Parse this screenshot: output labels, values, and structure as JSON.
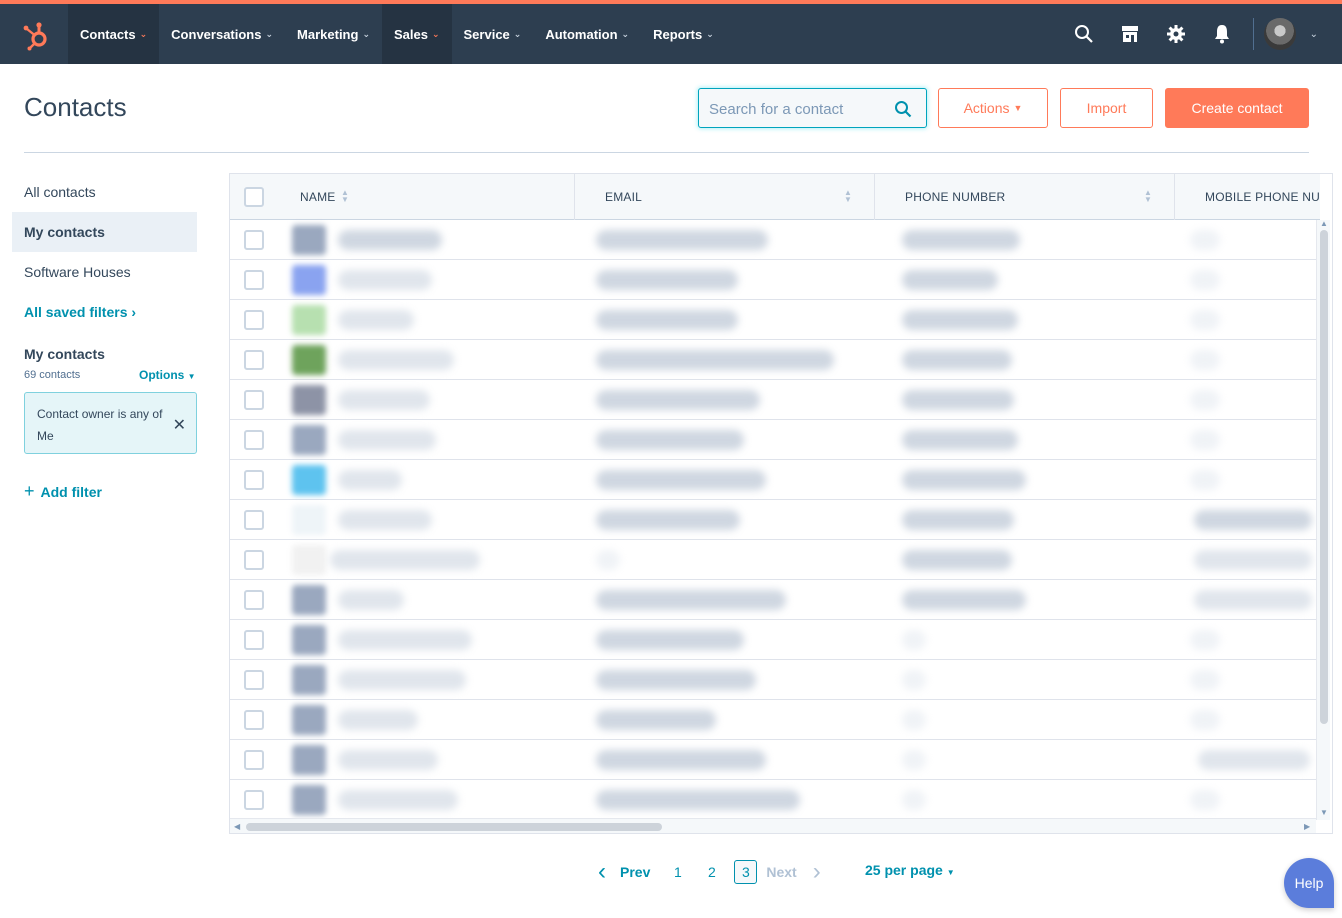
{
  "topnav": {
    "items": [
      {
        "label": "Contacts",
        "active": true
      },
      {
        "label": "Conversations",
        "active": false
      },
      {
        "label": "Marketing",
        "active": false
      },
      {
        "label": "Sales",
        "active": true
      },
      {
        "label": "Service",
        "active": false
      },
      {
        "label": "Automation",
        "active": false
      },
      {
        "label": "Reports",
        "active": false
      }
    ],
    "icons": [
      "search-icon",
      "marketplace-icon",
      "settings-gear-icon",
      "notifications-bell-icon"
    ],
    "brand_color": "#ff7a59",
    "bg_color": "#2d3e50"
  },
  "header": {
    "title": "Contacts",
    "search_placeholder": "Search for a contact",
    "actions_label": "Actions",
    "import_label": "Import",
    "create_label": "Create contact"
  },
  "sidebar": {
    "views": [
      {
        "label": "All contacts",
        "selected": false
      },
      {
        "label": "My contacts",
        "selected": true
      },
      {
        "label": "Software Houses",
        "selected": false
      }
    ],
    "saved_filters_label": "All saved filters",
    "current_view_title": "My contacts",
    "contact_count": "69 contacts",
    "options_label": "Options",
    "filter_text": "Contact owner is any of Me",
    "add_filter_label": "Add filter"
  },
  "table": {
    "columns": [
      "NAME",
      "EMAIL",
      "PHONE NUMBER",
      "MOBILE PHONE NU"
    ],
    "rows_note_blurred": true
  },
  "pagination": {
    "prev_label": "Prev",
    "pages": [
      "1",
      "2",
      "3"
    ],
    "current_page": "3",
    "next_label": "Next",
    "per_page_label": "25 per page"
  },
  "help_label": "Help"
}
